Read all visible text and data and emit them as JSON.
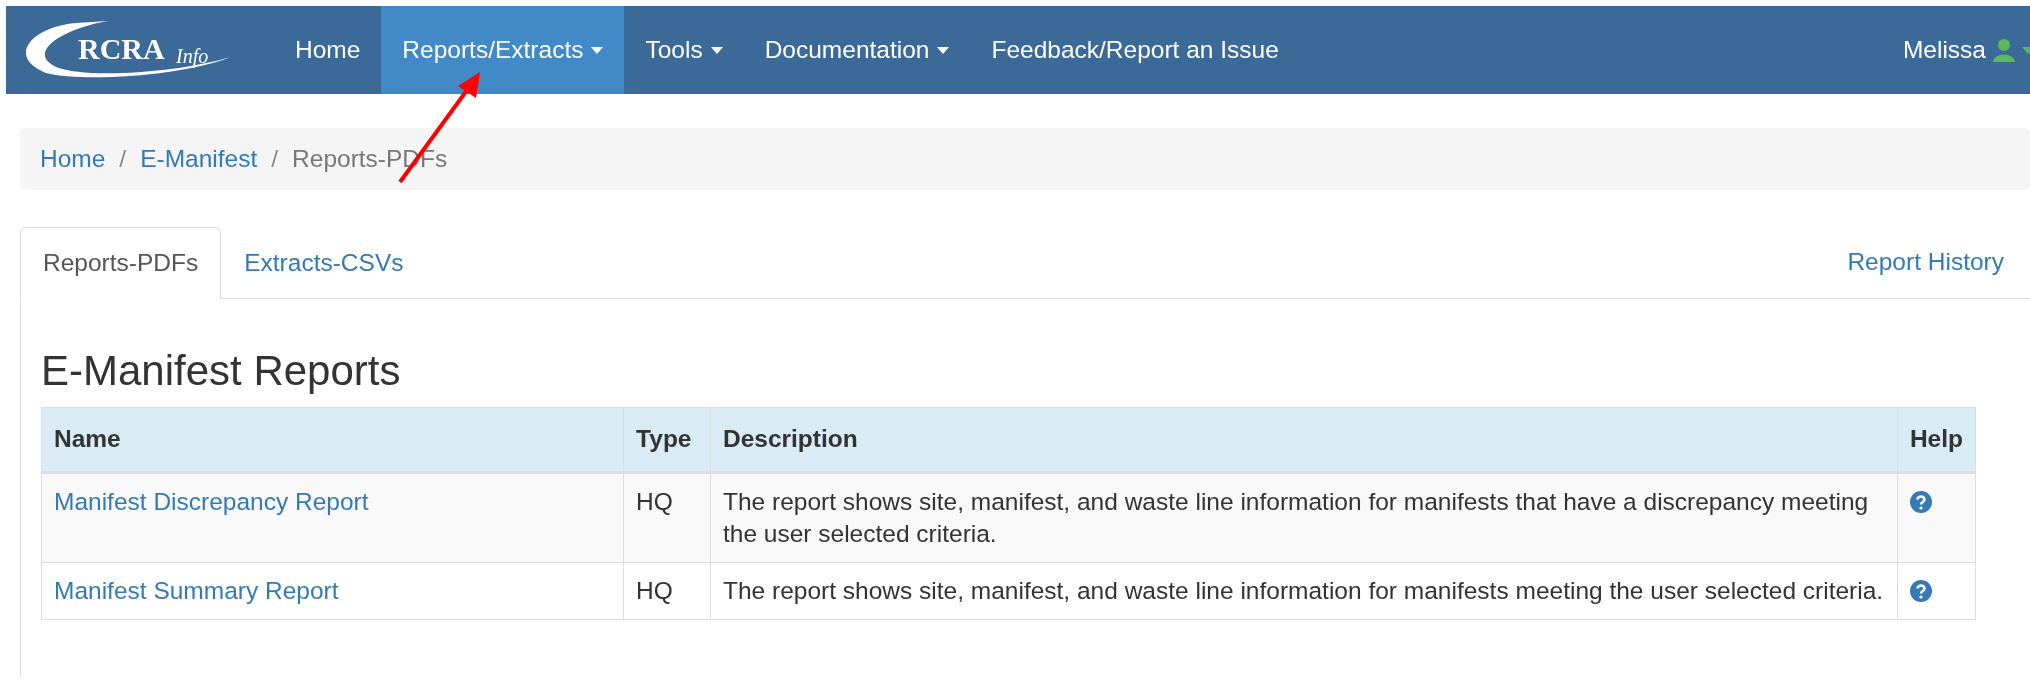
{
  "navbar": {
    "logo": {
      "main": "RCRA",
      "suffix": "Info"
    },
    "items": [
      {
        "label": "Home",
        "selected": false,
        "dropdown": false
      },
      {
        "label": "Reports/Extracts",
        "selected": true,
        "dropdown": true
      },
      {
        "label": "Tools",
        "selected": false,
        "dropdown": true
      },
      {
        "label": "Documentation",
        "selected": false,
        "dropdown": true
      },
      {
        "label": "Feedback/Report an Issue",
        "selected": false,
        "dropdown": false
      }
    ],
    "user": {
      "name": "Melissa"
    }
  },
  "breadcrumb": [
    {
      "label": "Home",
      "current": false
    },
    {
      "separator": "/",
      "label": "E-Manifest",
      "current": false
    },
    {
      "separator": "/",
      "label": "Reports-PDFs",
      "current": true
    }
  ],
  "tabs": [
    {
      "label": "Reports-PDFs",
      "selected": true
    },
    {
      "label": "Extracts-CSVs",
      "selected": false
    }
  ],
  "report_history_link": "Report History",
  "heading": "E-Manifest Reports",
  "table": {
    "columns": [
      "Name",
      "Type",
      "Description",
      "Help"
    ],
    "rows": [
      {
        "name": "Manifest Discrepancy Report",
        "type": "HQ",
        "description": "The report shows site, manifest, and waste line information for manifests that have a discrepancy meeting the user selected criteria."
      },
      {
        "name": "Manifest Summary Report",
        "type": "HQ",
        "description": "The report shows site, manifest, and waste line information for manifests meeting the user selected criteria."
      }
    ]
  }
}
